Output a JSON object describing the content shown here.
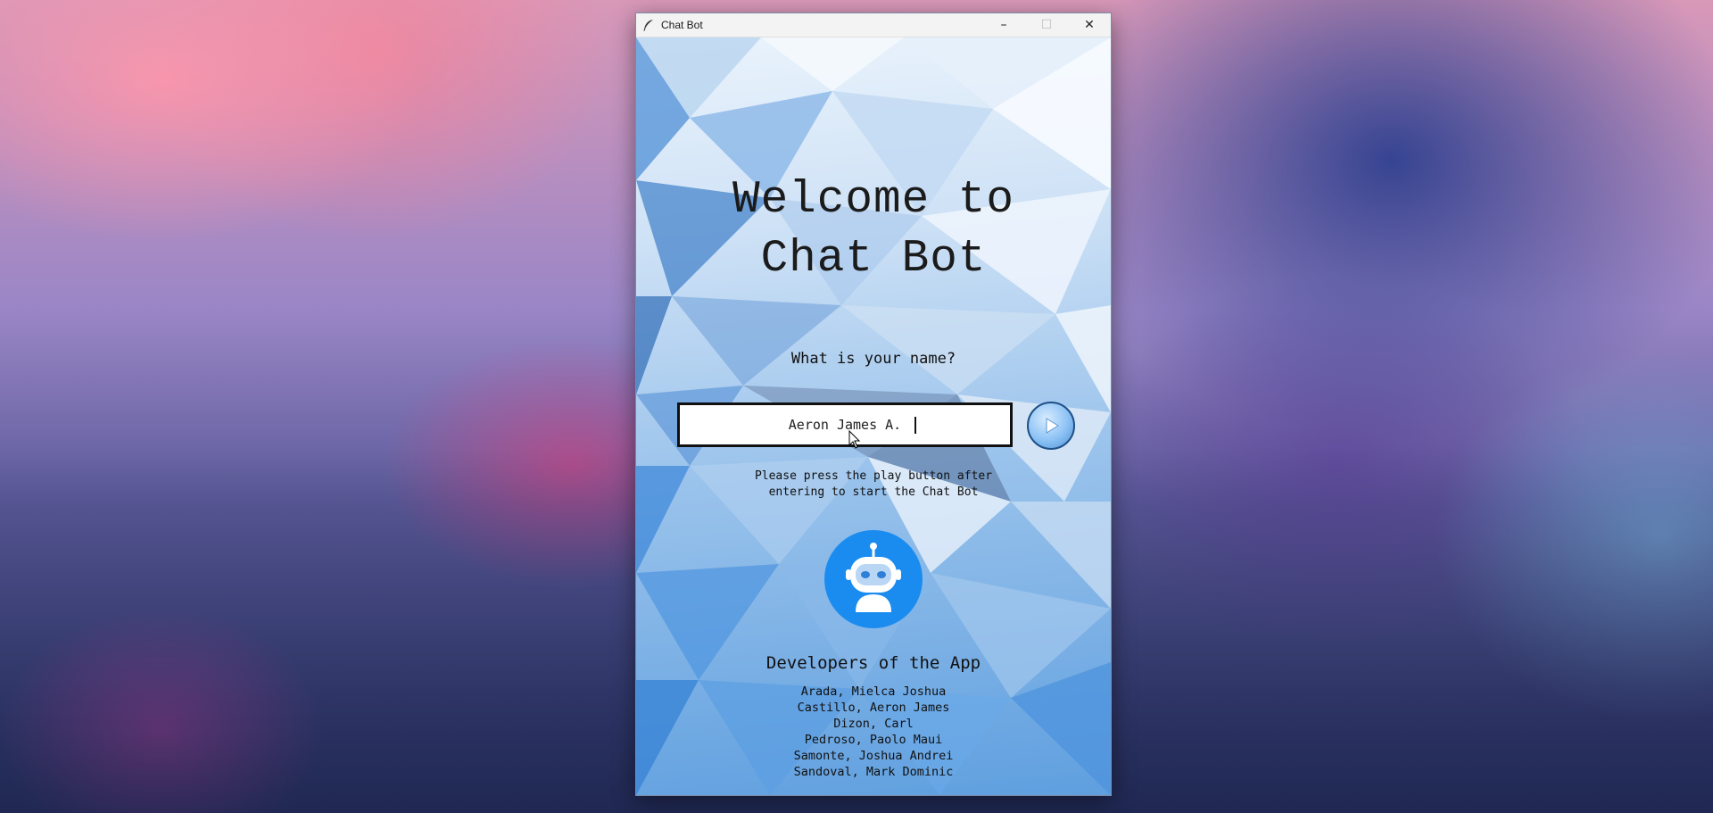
{
  "window": {
    "title": "Chat Bot",
    "controls": {
      "minimize": "–",
      "maximize": "☐",
      "close": "✕"
    }
  },
  "welcome": {
    "line1": "Welcome to",
    "line2": "Chat Bot"
  },
  "name_prompt": {
    "question": "What is your name?",
    "input_value": "Aeron James A.",
    "play_icon": "play-icon"
  },
  "hint": "Please press the play button after\nentering to start the Chat Bot",
  "robot_icon": "robot-icon",
  "developers": {
    "title": "Developers of the App",
    "names": [
      "Arada, Mielca Joshua",
      "Castillo, Aeron James",
      "Dizon, Carl",
      "Pedroso, Paolo Maui",
      "Samonte, Joshua Andrei",
      "Sandoval, Mark Dominic"
    ]
  },
  "colors": {
    "accent_blue": "#1a8cf0",
    "titlebar": "#f3f3f3"
  }
}
